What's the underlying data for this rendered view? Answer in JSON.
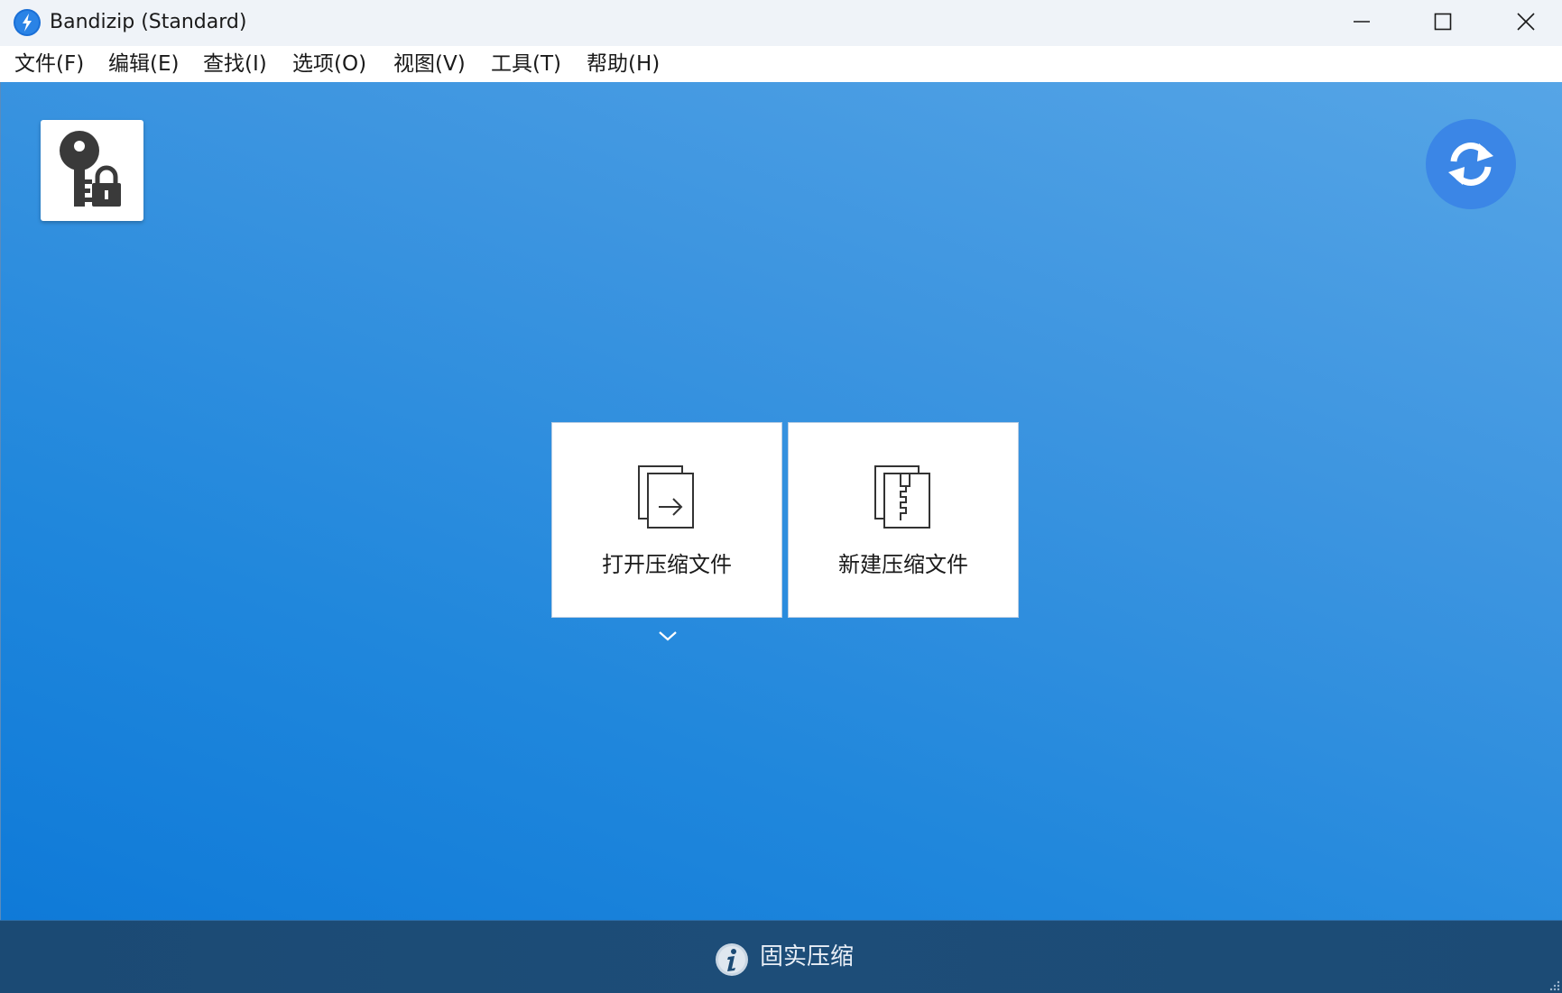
{
  "window": {
    "title": "Bandizip (Standard)"
  },
  "menu": {
    "items": [
      {
        "label": "文件(F)"
      },
      {
        "label": "编辑(E)"
      },
      {
        "label": "查找(I)"
      },
      {
        "label": "选项(O)"
      },
      {
        "label": "视图(V)"
      },
      {
        "label": "工具(T)"
      },
      {
        "label": "帮助(H)"
      }
    ]
  },
  "main": {
    "password_manager_icon": "key-lock-icon",
    "refresh_icon": "refresh-icon",
    "actions": [
      {
        "label": "打开压缩文件",
        "icon": "open-archive-icon"
      },
      {
        "label": "新建压缩文件",
        "icon": "new-archive-icon"
      }
    ],
    "open_dropdown_icon": "chevron-down-icon"
  },
  "status": {
    "text": "固实压缩",
    "icon": "info-icon"
  },
  "colors": {
    "accent": "#0f7ad8",
    "status_bar": "#1c4b75",
    "refresh_circle": "#3b86e6"
  }
}
